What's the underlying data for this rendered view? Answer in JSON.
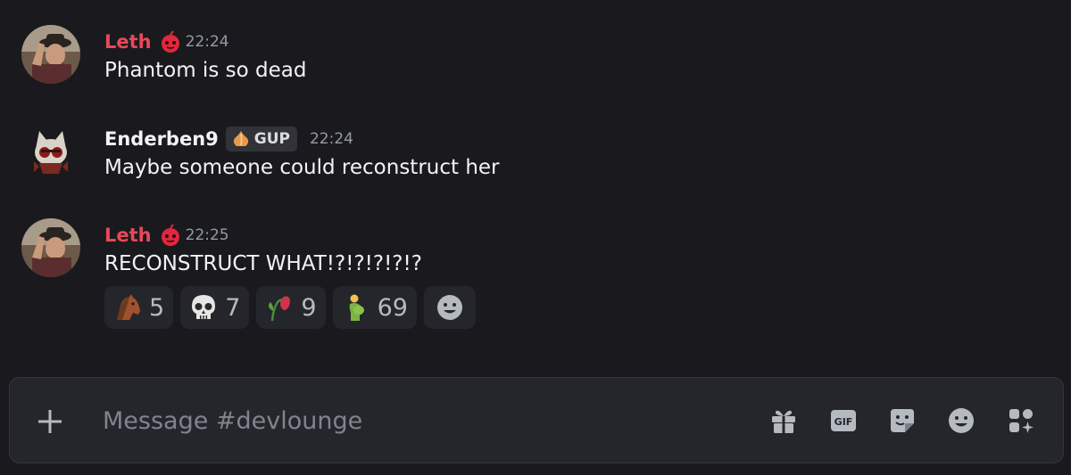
{
  "messages": [
    {
      "username": "Leth",
      "timestamp": "22:24",
      "text": "Phantom is so dead",
      "role_icon": "red-orb-icon"
    },
    {
      "username": "Enderben9",
      "tag": "GUP",
      "tag_icon": "onion-icon",
      "timestamp": "22:24",
      "text": "Maybe someone could reconstruct her"
    },
    {
      "username": "Leth",
      "timestamp": "22:25",
      "text": "RECONSTRUCT WHAT!?!?!?!?!?",
      "role_icon": "red-orb-icon",
      "reactions": [
        {
          "emoji": "horse-face-icon",
          "count": "5"
        },
        {
          "emoji": "skull-icon",
          "count": "7"
        },
        {
          "emoji": "wilted-flower-icon",
          "count": "9"
        },
        {
          "emoji": "pregnant-man-icon",
          "count": "69"
        }
      ]
    }
  ],
  "composer": {
    "placeholder": "Message #devlounge",
    "tools": [
      "gift-icon",
      "gif-icon",
      "sticker-icon",
      "emoji-icon",
      "apps-icon"
    ],
    "gif_label": "GIF"
  },
  "colors": {
    "background": "#1a1a1e",
    "leth_name": "#e8485a",
    "reaction_bg": "#25262b"
  }
}
